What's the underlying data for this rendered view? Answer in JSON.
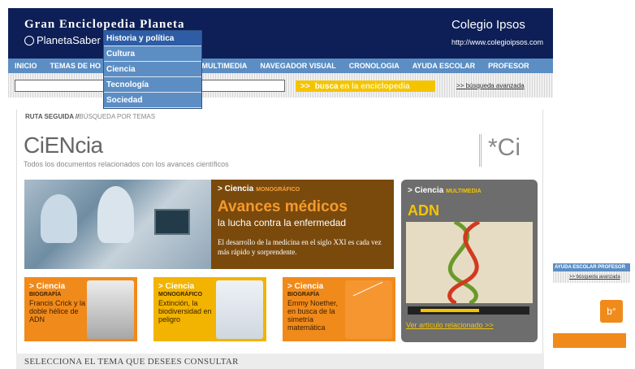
{
  "header": {
    "brand": "Gran Enciclopedia Planeta",
    "brand_sub": "PlanetaSaber",
    "school_name": "Colegio Ipsos",
    "school_url": "http://www.colegioipsos.com"
  },
  "nav": [
    "INICIO",
    "TEMAS DE HO",
    "AS",
    "MULTIMEDIA",
    "NAVEGADOR VISUAL",
    "CRONOLOGIA",
    "AYUDA ESCOLAR",
    "PROFESOR"
  ],
  "dropdown": [
    "Historia y política",
    "Cultura",
    "Ciencia",
    "Tecnología",
    "Sociedad"
  ],
  "search": {
    "button_arrow": ">>",
    "button_a": "busca",
    "button_b": "en la enciclopedia",
    "advanced": ">> búsqueda avanzada",
    "value": ""
  },
  "breadcrumb": {
    "bold": "RUTA SEGUIDA //",
    "rest": "BÚSQUEDA POR TEMAS"
  },
  "section": {
    "title": "CiENcia",
    "desc": "Todos los documentos relacionados con los avances científicos",
    "logo": "*Ci"
  },
  "hero": {
    "tag": "> Ciencia",
    "tag_sub": "MONOGRÁFICO",
    "heading": "Avances médicos",
    "subheading": "la lucha contra la enfermedad",
    "text": "El desarrollo de la medicina en el siglo XXI es cada vez más rápido y sorprendente."
  },
  "side": {
    "tag": "> Ciencia",
    "tag_sub": "MULTIMEDIA",
    "title": "ADN",
    "link": "Ver artículo relacionado >>",
    "progress": 0.55
  },
  "cards": [
    {
      "tag": "> Ciencia",
      "sub": "BIOGRAFÍA",
      "text": "Francis Crick y la doble hélice de ADN"
    },
    {
      "tag": "> Ciencia",
      "sub": "MONOGRÁFICO",
      "text": "Extinción, la biodiversidad en peligro"
    },
    {
      "tag": "> Ciencia",
      "sub": "BIOGRAFÍA",
      "text": "Emmy Noether, en busca de la simetría matemática"
    }
  ],
  "bottom": "SELECCIONA EL TEMA QUE DESEES CONSULTAR",
  "fragment": {
    "nav": "AYUDA ESCOLAR   PROFESOR",
    "adv": ">> búsqueda avanzada",
    "logo": "b°"
  }
}
